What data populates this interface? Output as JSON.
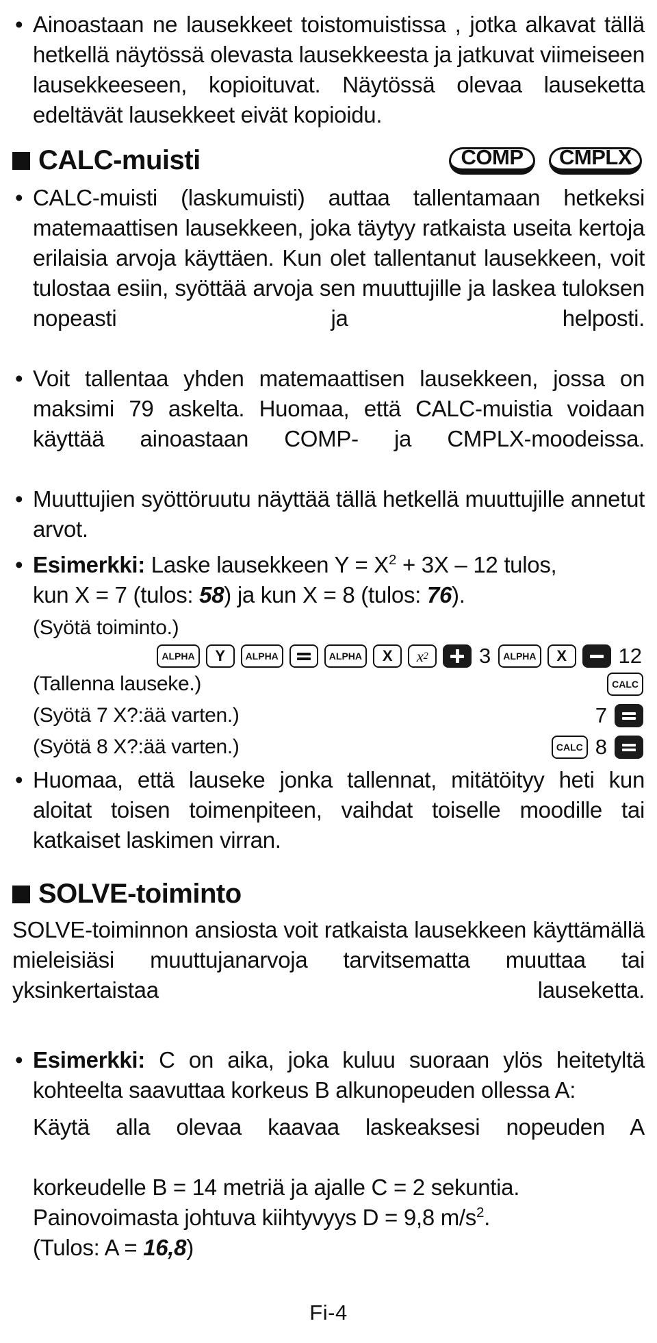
{
  "intro": {
    "bullet": "•",
    "text": "Ainoastaan ne lausekkeet toistomuistissa , jotka alkavat tällä hetkellä näytössä olevasta lausekkeesta ja jatkuvat viimeiseen lausekkeeseen, kopioituvat. Näytössä olevaa lauseketta edeltävät lausekkeet eivät kopioidu."
  },
  "calc_section": {
    "title": "CALC-muisti",
    "badges": [
      {
        "label": "COMP"
      },
      {
        "label": "CMPLX"
      }
    ],
    "bullets": [
      "CALC-muisti (laskumuisti) auttaa tallentamaan hetkeksi matemaattisen lausekkeen, joka täytyy ratkaista useita kertoja erilaisia arvoja käyttäen. Kun olet tallentanut lausekkeen, voit tulostaa esiin, syöttää arvoja sen muuttujille ja laskea tuloksen nopeasti ja helposti.",
      "Voit tallentaa yhden matemaattisen lausekkeen, jossa on maksimi 79 askelta. Huomaa, että CALC-muistia voidaan käyttää ainoastaan COMP- ja CMPLX-moodeissa.",
      "Muuttujien syöttöruutu näyttää tällä hetkellä muuttujille annetut arvot."
    ],
    "example": {
      "label": "Esimerkki:",
      "line1_rest": " Laske lausekkeen Y = X",
      "line1_sup": "2",
      "line1_tail": " + 3X – 12 tulos,",
      "line2_a": "kun X = 7 (tulos: ",
      "line2_val1": "58",
      "line2_b": ") ja kun X = 8 (tulos: ",
      "line2_val2": "76",
      "line2_c": ")."
    },
    "steps": [
      {
        "caption": "(Syötä toiminto.)",
        "keys": [
          {
            "type": "key",
            "label": "ALPHA",
            "style": "small"
          },
          {
            "type": "key",
            "label": "Y",
            "style": ""
          },
          {
            "type": "key",
            "label": "ALPHA",
            "style": "small"
          },
          {
            "type": "key",
            "label": "=",
            "style": "equals"
          },
          {
            "type": "key",
            "label": "ALPHA",
            "style": "small"
          },
          {
            "type": "key",
            "label": "X",
            "style": ""
          },
          {
            "type": "key",
            "label": "x²",
            "style": "italic"
          },
          {
            "type": "key",
            "label": "+",
            "style": "dark-plus"
          },
          {
            "type": "text",
            "label": "3"
          },
          {
            "type": "key",
            "label": "ALPHA",
            "style": "small"
          },
          {
            "type": "key",
            "label": "X",
            "style": ""
          },
          {
            "type": "key",
            "label": "−",
            "style": "dark-minus"
          },
          {
            "type": "text",
            "label": "12"
          }
        ]
      },
      {
        "caption": "(Tallenna lauseke.)",
        "keys": [
          {
            "type": "key",
            "label": "CALC",
            "style": "small"
          }
        ]
      },
      {
        "caption": "(Syötä 7 X?:ää varten.)",
        "keys": [
          {
            "type": "text",
            "label": "7"
          },
          {
            "type": "key",
            "label": "=",
            "style": "dark-equals"
          }
        ]
      },
      {
        "caption": "(Syötä 8 X?:ää varten.)",
        "keys": [
          {
            "type": "key",
            "label": "CALC",
            "style": "small"
          },
          {
            "type": "text",
            "label": "8"
          },
          {
            "type": "key",
            "label": "=",
            "style": "dark-equals"
          }
        ]
      }
    ],
    "closing_bullet": "Huomaa, että lauseke jonka tallennat, mitätöityy heti kun aloitat toisen toimenpiteen, vaihdat toiselle moodille tai katkaiset laskimen virran."
  },
  "solve_section": {
    "title": "SOLVE-toiminto",
    "intro": "SOLVE-toiminnon ansiosta voit ratkaista lausekkeen käyttämällä mieleisiäsi muuttujanarvoja tarvitsematta muuttaa tai yksinkertaistaa lauseketta.",
    "example": {
      "label": "Esimerkki:",
      "text": " C on aika, joka kuluu suoraan ylös heitetyltä kohteelta saavuttaa korkeus B alkunopeuden ollessa A:"
    },
    "body_line1": "Käytä alla olevaa kaavaa laskeaksesi nopeuden A",
    "body_line2": "korkeudelle B = 14 metriä ja ajalle C = 2 sekuntia.",
    "body_line3_a": "Painovoimasta johtuva kiihtyvyys D = 9,8 m/s",
    "body_line3_sup": "2",
    "body_line3_b": ".",
    "result_a": "(Tulos: A = ",
    "result_val": "16,8",
    "result_b": ")"
  },
  "footer": {
    "page_label": "Fi-4"
  }
}
